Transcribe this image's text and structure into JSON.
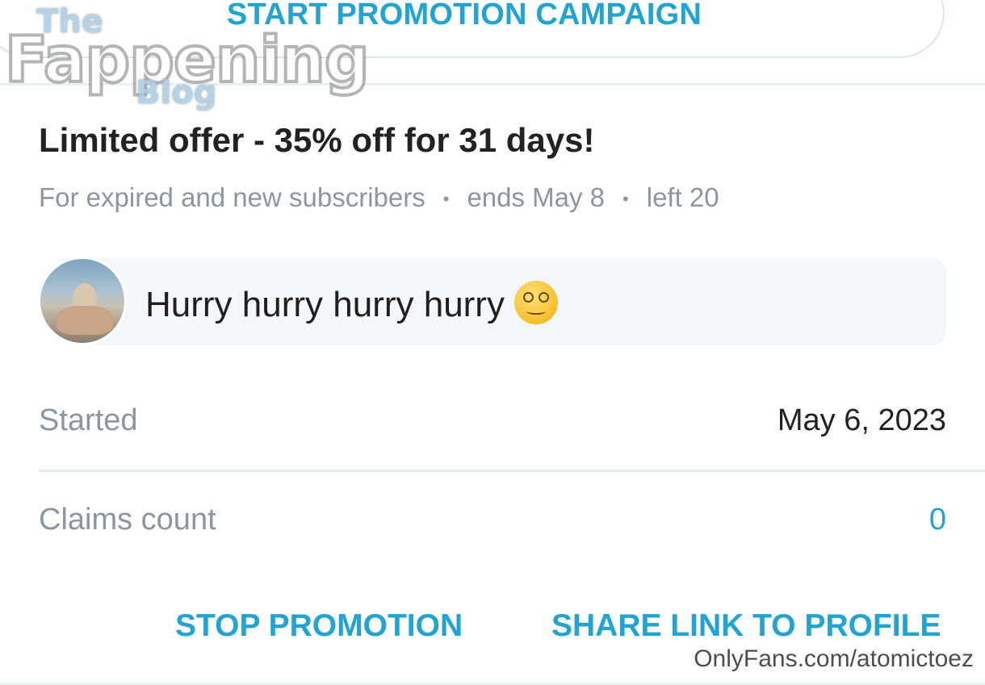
{
  "top_button": {
    "label": "START PROMOTION CAMPAIGN"
  },
  "watermark": {
    "line1": "The",
    "line2": "Fappening",
    "line3": "Blog"
  },
  "offer": {
    "title": "Limited offer - 35% off for 31 days!",
    "audience": "For expired and new subscribers",
    "ends": "ends May 8",
    "left": "left 20"
  },
  "message": {
    "text": "Hurry hurry hurry hurry",
    "emoji_icon": "dizzy-face-emoji"
  },
  "details": {
    "started_label": "Started",
    "started_value": "May 6, 2023",
    "claims_label": "Claims count",
    "claims_value": "0"
  },
  "actions": {
    "stop_label": "STOP PROMOTION",
    "share_label": "SHARE LINK TO PROFILE"
  },
  "footer": {
    "source": "OnlyFans.com/atomictoez"
  },
  "colors": {
    "accent": "#1fa4d6",
    "muted": "#8a96a0",
    "text": "#222222"
  }
}
